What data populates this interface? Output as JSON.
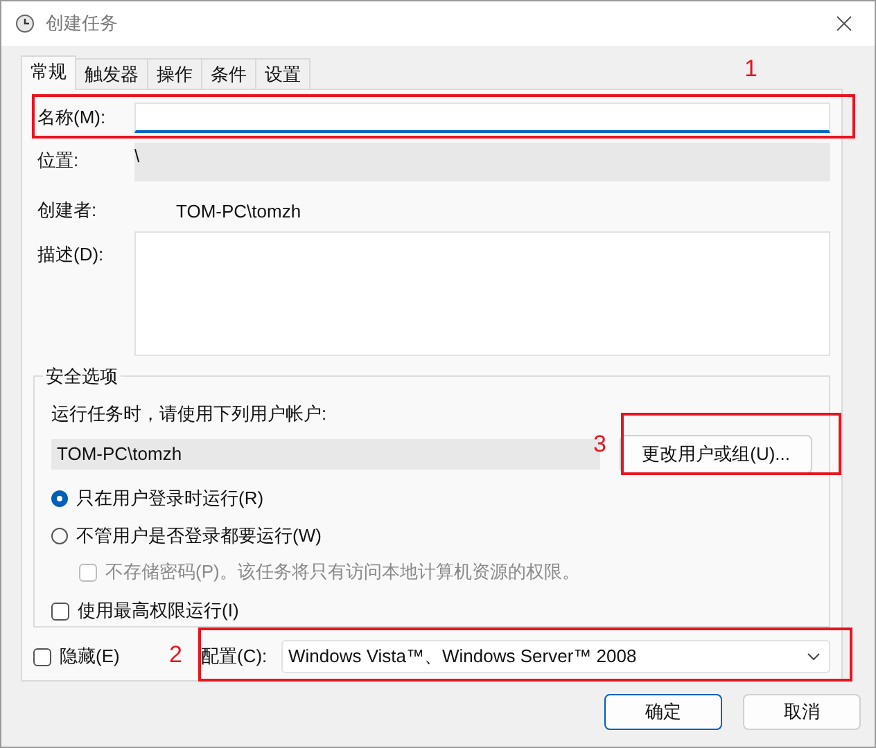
{
  "window": {
    "title": "创建任务"
  },
  "tabs": [
    {
      "label": "常规",
      "selected": true
    },
    {
      "label": "触发器",
      "selected": false
    },
    {
      "label": "操作",
      "selected": false
    },
    {
      "label": "条件",
      "selected": false
    },
    {
      "label": "设置",
      "selected": false
    }
  ],
  "name": {
    "label": "名称(M):"
  },
  "location": {
    "label": "位置:",
    "value": "\\"
  },
  "author": {
    "label": "创建者:",
    "value": "TOM-PC\\tomzh"
  },
  "description": {
    "label": "描述(D):"
  },
  "security": {
    "title": "安全选项",
    "prompt": "运行任务时，请使用下列用户帐户:",
    "account": "TOM-PC\\tomzh",
    "change_button": "更改用户或组(U)...",
    "run_options": [
      {
        "label": "只在用户登录时运行(R)",
        "selected": true
      },
      {
        "label": "不管用户是否登录都要运行(W)",
        "selected": false
      }
    ],
    "no_password": {
      "label": "不存储密码(P)。该任务将只有访问本地计算机资源的权限。",
      "checked": false,
      "disabled": true
    },
    "highest": {
      "label": "使用最高权限运行(I)",
      "checked": false,
      "disabled": false
    }
  },
  "hidden": {
    "label": "隐藏(E)",
    "checked": false
  },
  "configure": {
    "label": "配置(C):",
    "value": "Windows Vista™、Windows Server™ 2008"
  },
  "buttons": [
    {
      "label": "确定",
      "default": true
    },
    {
      "label": "取消",
      "default": false
    }
  ],
  "annotations": [
    {
      "label": "1"
    },
    {
      "label": "2"
    },
    {
      "label": "3"
    }
  ]
}
